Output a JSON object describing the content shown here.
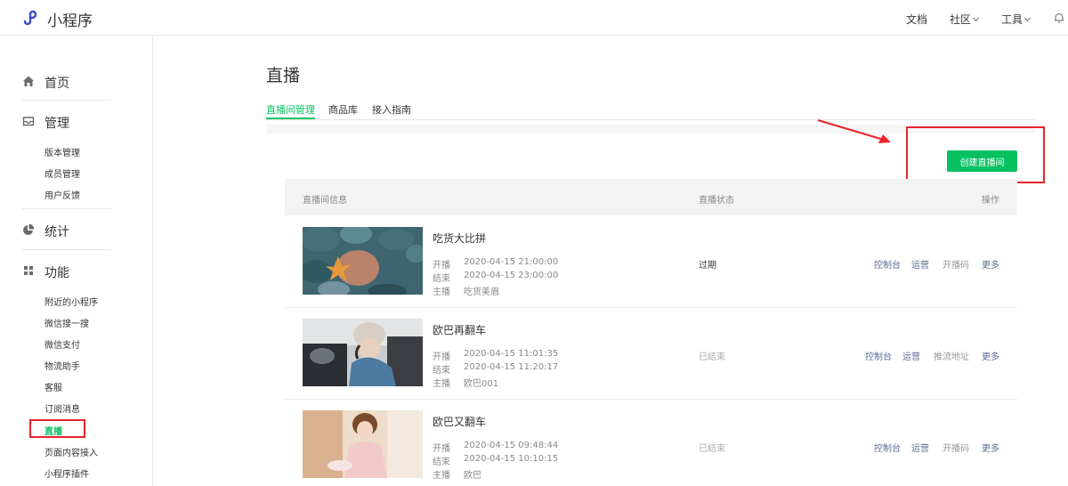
{
  "brand": {
    "name": "小程序",
    "accent": "#07c160",
    "logo_color": "#3b4ec9"
  },
  "topnav": {
    "docs": "文档",
    "community": "社区",
    "tools": "工具"
  },
  "sidebar": {
    "home": "首页",
    "manage": {
      "title": "管理",
      "items": [
        "版本管理",
        "成员管理",
        "用户反馈"
      ]
    },
    "stats": "统计",
    "features": {
      "title": "功能",
      "items": [
        "附近的小程序",
        "微信搜一搜",
        "微信支付",
        "物流助手",
        "客服",
        "订阅消息",
        "直播",
        "页面内容接入",
        "小程序插件"
      ]
    }
  },
  "page": {
    "title": "直播",
    "tabs": [
      "直播间管理",
      "商品库",
      "接入指南"
    ],
    "create_button": "创建直播间"
  },
  "table": {
    "headers": [
      "直播间信息",
      "直播状态",
      "操作"
    ],
    "meta_labels": {
      "start": "开播",
      "end": "结束",
      "host": "主播"
    },
    "rows": [
      {
        "title": "吃货大比拼",
        "start": "2020-04-15 21:00:00",
        "end": "2020-04-15 23:00:00",
        "host": "吃货美眉",
        "status": "过期",
        "ops": [
          "控制台",
          "运营",
          "开播码",
          "更多"
        ]
      },
      {
        "title": "欧巴再翻车",
        "start": "2020-04-15 11:01:35",
        "end": "2020-04-15 11:20:17",
        "host": "欧巴001",
        "status": "已结束",
        "ops": [
          "控制台",
          "运营",
          "推流地址",
          "更多"
        ]
      },
      {
        "title": "欧巴又翻车",
        "start": "2020-04-15 09:48:44",
        "end": "2020-04-15 10:10:15",
        "host": "欧巴",
        "status": "已结束",
        "ops": [
          "控制台",
          "运营",
          "开播码",
          "更多"
        ]
      }
    ]
  }
}
